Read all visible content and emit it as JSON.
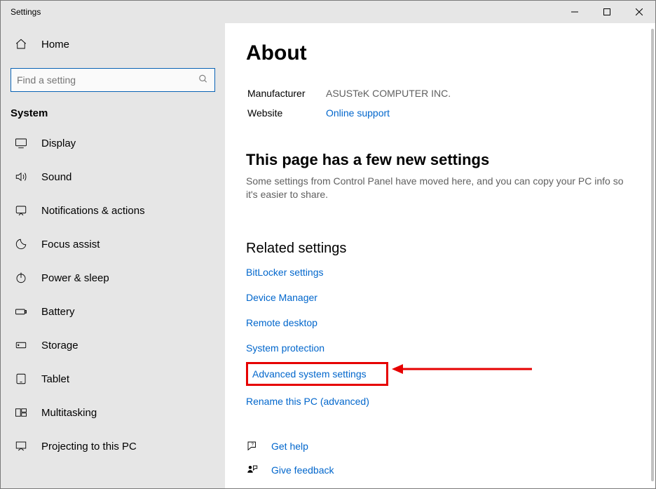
{
  "window": {
    "title": "Settings"
  },
  "sidebar": {
    "home_label": "Home",
    "search_placeholder": "Find a setting",
    "group_label": "System",
    "items": [
      {
        "label": "Display"
      },
      {
        "label": "Sound"
      },
      {
        "label": "Notifications & actions"
      },
      {
        "label": "Focus assist"
      },
      {
        "label": "Power & sleep"
      },
      {
        "label": "Battery"
      },
      {
        "label": "Storage"
      },
      {
        "label": "Tablet"
      },
      {
        "label": "Multitasking"
      },
      {
        "label": "Projecting to this PC"
      }
    ]
  },
  "page": {
    "title": "About",
    "manufacturer_label": "Manufacturer",
    "manufacturer_value": "ASUSTeK COMPUTER INC.",
    "website_label": "Website",
    "website_link": "Online support",
    "new_settings_title": "This page has a few new settings",
    "new_settings_body": "Some settings from Control Panel have moved here, and you can copy your PC info so it's easier to share.",
    "related_title": "Related settings",
    "related_links": {
      "bitlocker": "BitLocker settings",
      "devmgr": "Device Manager",
      "remote": "Remote desktop",
      "sysprot": "System protection",
      "advsys": "Advanced system settings",
      "rename": "Rename this PC (advanced)"
    },
    "support": {
      "help": "Get help",
      "feedback": "Give feedback"
    }
  }
}
